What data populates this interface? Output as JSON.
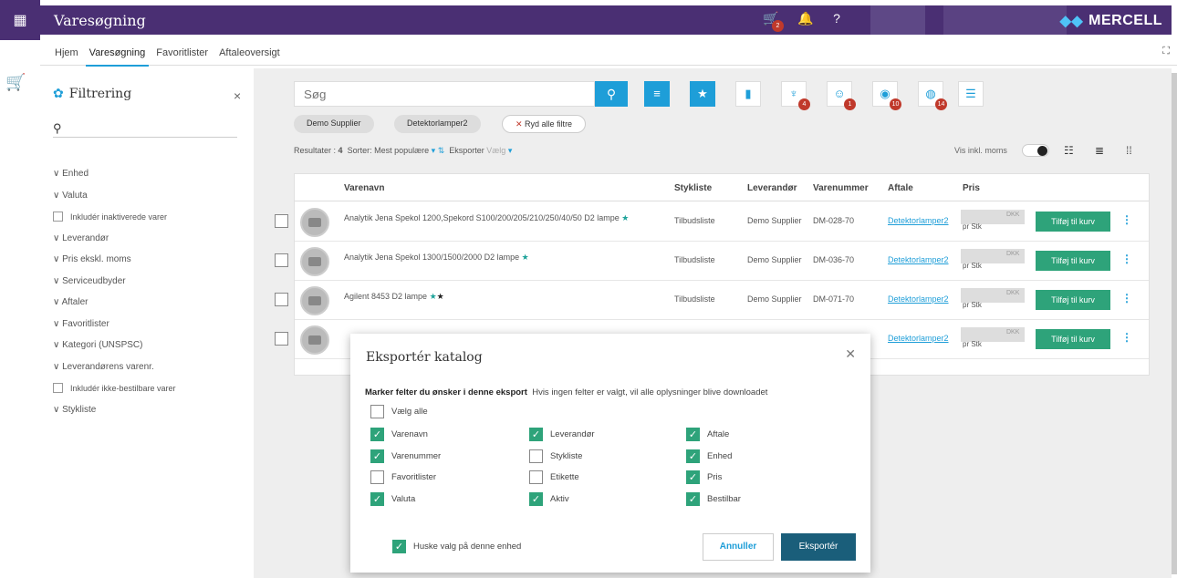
{
  "app": {
    "title": "Varesøgning",
    "cart_badge": "2",
    "logo": "MERCELL"
  },
  "nav": {
    "tabs": [
      "Hjem",
      "Varesøgning",
      "Favoritlister",
      "Aftaleoversigt"
    ]
  },
  "filter": {
    "title": "Filtrering",
    "items": [
      {
        "label": "Enhed",
        "type": "group"
      },
      {
        "label": "Valuta",
        "type": "group"
      },
      {
        "label": "Inkludér inaktiverede varer",
        "type": "check"
      },
      {
        "label": "Leverandør",
        "type": "group"
      },
      {
        "label": "Pris ekskl. moms",
        "type": "group"
      },
      {
        "label": "Serviceudbyder",
        "type": "group"
      },
      {
        "label": "Aftaler",
        "type": "group"
      },
      {
        "label": "Favoritlister",
        "type": "group"
      },
      {
        "label": "Kategori (UNSPSC)",
        "type": "group"
      },
      {
        "label": "Leverandørens varenr.",
        "type": "group"
      },
      {
        "label": "Inkludér ikke-bestilbare varer",
        "type": "check"
      },
      {
        "label": "Stykliste",
        "type": "group"
      }
    ]
  },
  "search": {
    "placeholder": "Søg"
  },
  "toolbar_badges": [
    "4",
    "1",
    "10",
    "14"
  ],
  "chips": [
    "Demo Supplier",
    "Detektorlamper2",
    "Ryd alle filtre"
  ],
  "results": {
    "label": "Resultater :",
    "count": "4",
    "sort_label": "Sorter:",
    "sort_value": "Mest populære",
    "export_label": "Eksporter",
    "export_value": "Vælg",
    "vis_moms": "Vis inkl. moms"
  },
  "table": {
    "headers": [
      "Varenavn",
      "Stykliste",
      "Leverandør",
      "Varenummer",
      "Aftale",
      "Pris"
    ],
    "rows": [
      {
        "name": "Analytik Jena Spekol 1200,Spekord S100/200/205/210/250/40/50 D2 lampe",
        "stykliste": "Tilbudsliste",
        "lev": "Demo Supplier",
        "num": "DM-028-70",
        "aftale": "Detektorlamper2",
        "currency": "DKK",
        "unit": "pr Stk",
        "button": "Tilføj til kurv"
      },
      {
        "name": "Analytik Jena Spekol 1300/1500/2000 D2 lampe",
        "stykliste": "Tilbudsliste",
        "lev": "Demo Supplier",
        "num": "DM-036-70",
        "aftale": "Detektorlamper2",
        "currency": "DKK",
        "unit": "pr Stk",
        "button": "Tilføj til kurv"
      },
      {
        "name": "Agilent 8453 D2 lampe",
        "stykliste": "Tilbudsliste",
        "lev": "Demo Supplier",
        "num": "DM-071-70",
        "aftale": "Detektorlamper2",
        "currency": "DKK",
        "unit": "pr Stk",
        "button": "Tilføj til kurv"
      },
      {
        "aftale": "Detektorlamper2",
        "currency": "DKK",
        "unit": "pr Stk",
        "button": "Tilføj til kurv"
      }
    ]
  },
  "modal": {
    "title": "Eksportér katalog",
    "instr_bold": "Marker felter du ønsker i denne eksport",
    "instr": "Hvis ingen felter er valgt, vil alle oplysninger blive downloadet",
    "select_all": "Vælg alle",
    "fields": [
      {
        "label": "Varenavn",
        "checked": true
      },
      {
        "label": "Leverandør",
        "checked": true
      },
      {
        "label": "Aftale",
        "checked": true
      },
      {
        "label": "Varenummer",
        "checked": true
      },
      {
        "label": "Stykliste",
        "checked": false
      },
      {
        "label": "Enhed",
        "checked": true
      },
      {
        "label": "Favoritlister",
        "checked": false
      },
      {
        "label": "Etikette",
        "checked": false
      },
      {
        "label": "Pris",
        "checked": true
      },
      {
        "label": "Valuta",
        "checked": true
      },
      {
        "label": "Aktiv",
        "checked": true
      },
      {
        "label": "Bestilbar",
        "checked": true
      }
    ],
    "remember": "Huske valg på denne enhed",
    "cancel": "Annuller",
    "export": "Eksportér"
  }
}
